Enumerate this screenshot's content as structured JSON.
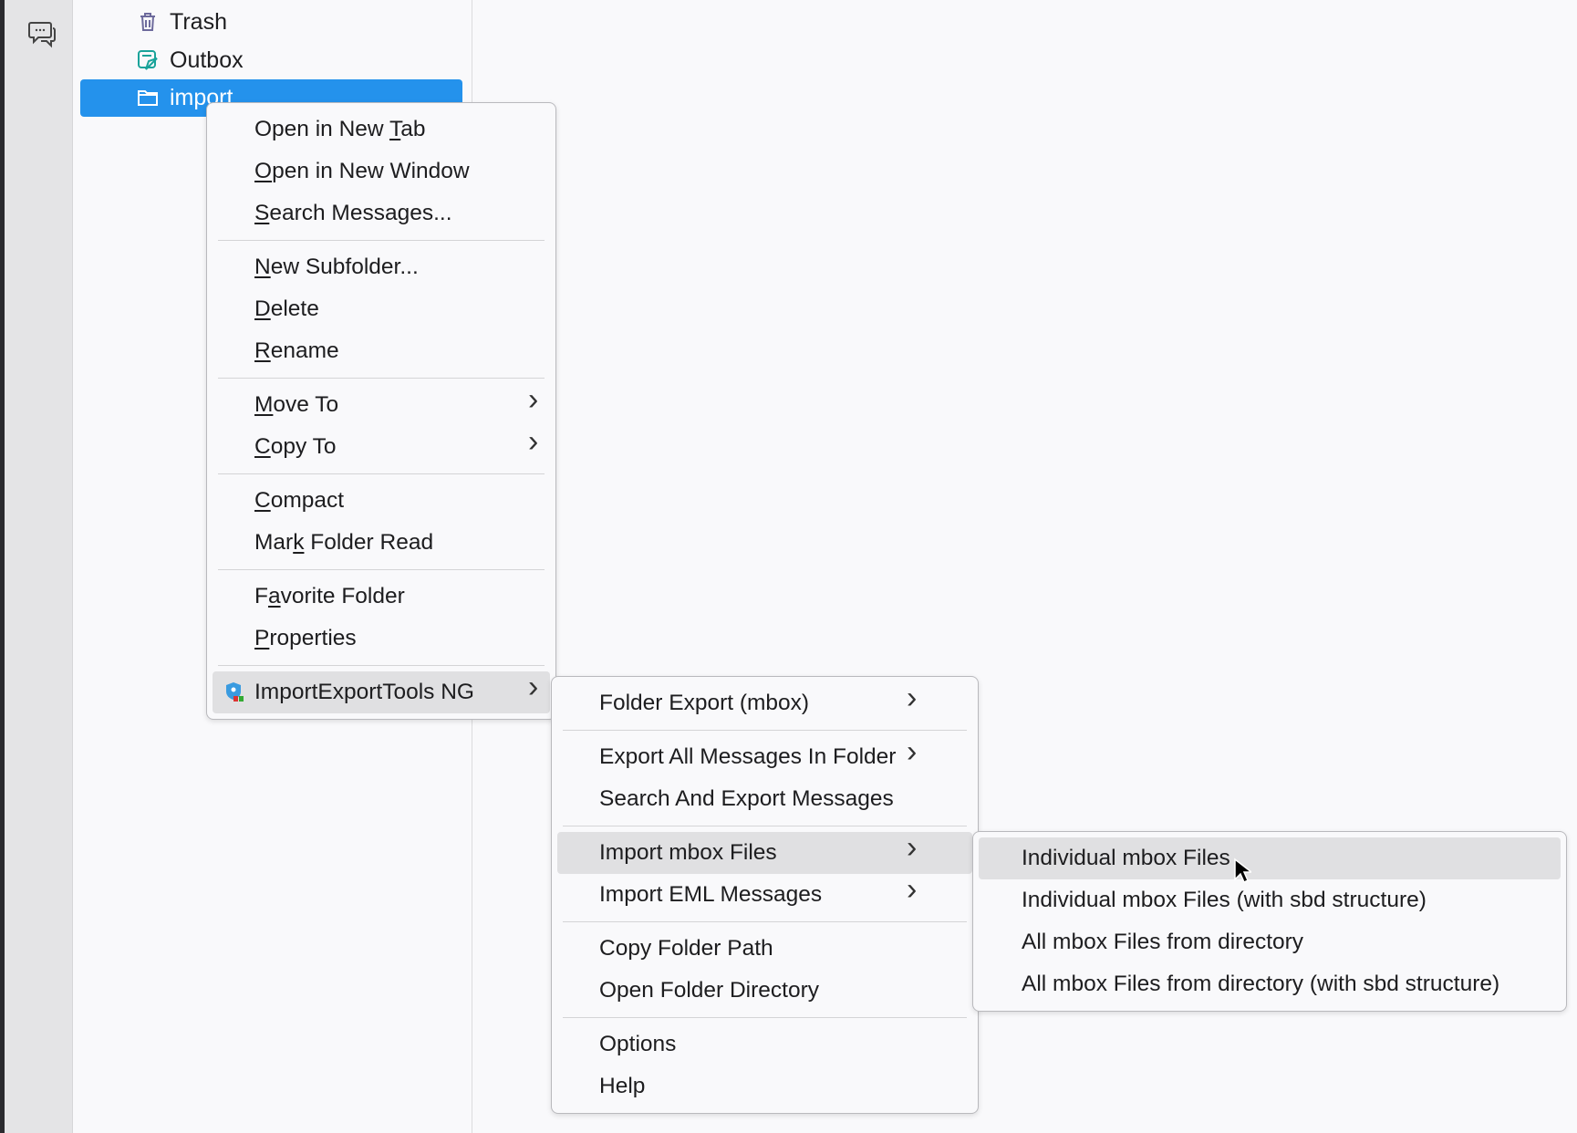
{
  "sidebar": {
    "rail_icon": "chat-icon",
    "folders": [
      {
        "label": "Trash",
        "icon": "trash-icon",
        "selected": false
      },
      {
        "label": "Outbox",
        "icon": "outbox-icon",
        "selected": false
      },
      {
        "label": "import",
        "icon": "folder-icon",
        "selected": true
      }
    ]
  },
  "colors": {
    "selection": "#2492ec",
    "menu_highlight": "#e0e0e2"
  },
  "context_menu": {
    "items": [
      {
        "label": "Open in New Tab",
        "key": 12
      },
      {
        "label": "Open in New Window",
        "key": 0
      },
      {
        "label": "Search Messages...",
        "key": 0
      },
      {
        "sep": true
      },
      {
        "label": "New Subfolder...",
        "key": 0
      },
      {
        "label": "Delete",
        "key": 0
      },
      {
        "label": "Rename",
        "key": 0
      },
      {
        "sep": true
      },
      {
        "label": "Move To",
        "key": 0,
        "submenu": true
      },
      {
        "label": "Copy To",
        "key": 0,
        "submenu": true
      },
      {
        "sep": true
      },
      {
        "label": "Compact",
        "key": 0
      },
      {
        "label": "Mark Folder Read",
        "key": 3
      },
      {
        "sep": true
      },
      {
        "label": "Favorite Folder",
        "key": 1
      },
      {
        "label": "Properties",
        "key": 0
      },
      {
        "sep": true
      },
      {
        "label": "ImportExportTools NG",
        "submenu": true,
        "highlighted": true,
        "icon": "importexporttools-addon-icon"
      }
    ]
  },
  "importexport_menu": {
    "items": [
      {
        "label": "Folder Export (mbox)",
        "submenu": true
      },
      {
        "sep": true
      },
      {
        "label": "Export All Messages In Folder",
        "submenu": true
      },
      {
        "label": "Search And Export Messages"
      },
      {
        "sep": true
      },
      {
        "label": "Import mbox Files",
        "submenu": true,
        "highlighted": true
      },
      {
        "label": "Import EML Messages",
        "submenu": true
      },
      {
        "sep": true
      },
      {
        "label": "Copy Folder Path"
      },
      {
        "label": "Open Folder Directory"
      },
      {
        "sep": true
      },
      {
        "label": "Options"
      },
      {
        "label": "Help"
      }
    ]
  },
  "import_mbox_menu": {
    "items": [
      {
        "label": "Individual mbox Files",
        "highlighted": true
      },
      {
        "label": "Individual mbox Files (with sbd structure)"
      },
      {
        "label": "All mbox Files from directory"
      },
      {
        "label": "All mbox Files from directory (with sbd structure)"
      }
    ]
  }
}
